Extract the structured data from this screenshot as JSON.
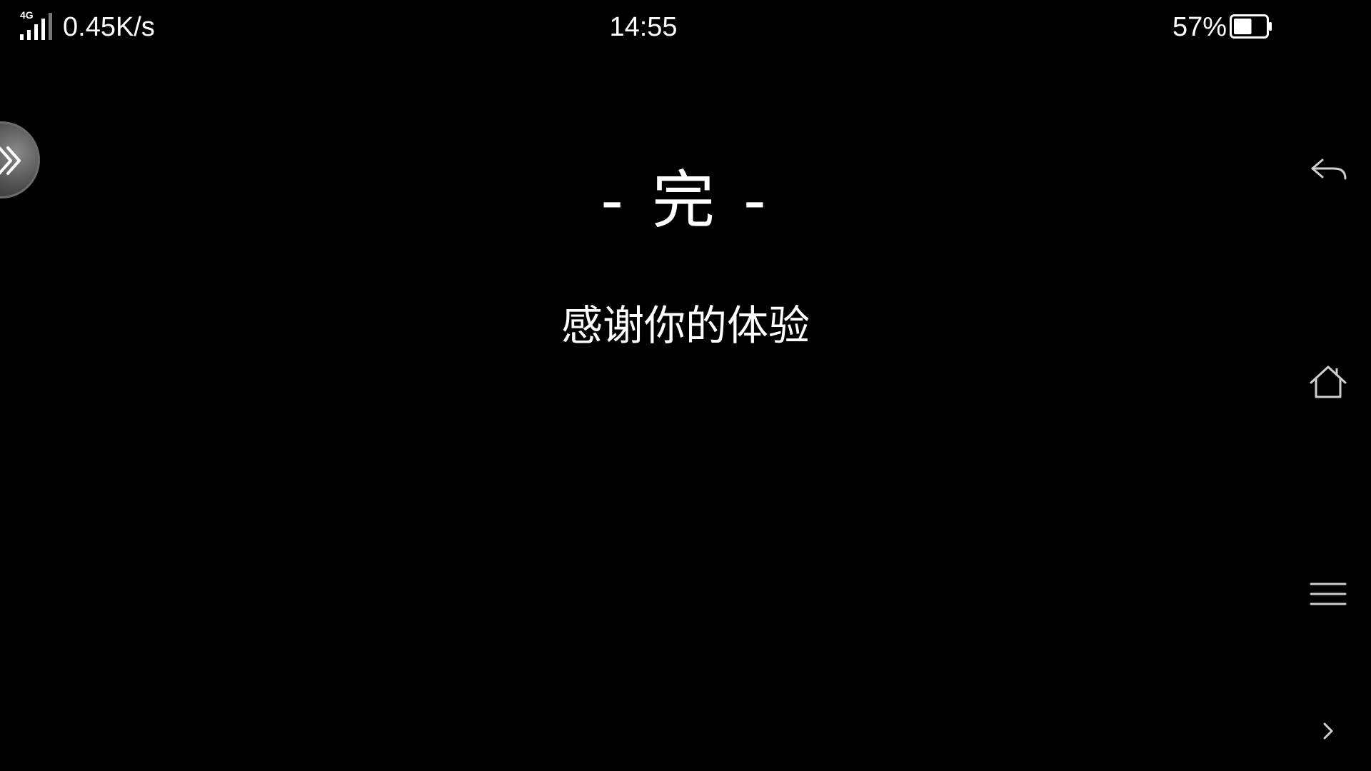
{
  "status_bar": {
    "network_type": "4G",
    "network_speed": "0.45K/s",
    "time": "14:55",
    "battery_percent": "57%",
    "battery_level": 0.57
  },
  "content": {
    "title": "- 完 -",
    "subtitle": "感谢你的体验"
  },
  "icons": {
    "signal": "signal-icon",
    "battery": "battery-icon",
    "float_ball": "double-chevron-right-icon",
    "back": "back-arrow-icon",
    "home": "home-icon",
    "menu": "menu-icon",
    "expand": "chevron-right-icon"
  },
  "colors": {
    "background": "#000000",
    "text": "#ffffff",
    "nav_icon": "#cfcfcf",
    "float_ball": "#5a5a5a"
  }
}
